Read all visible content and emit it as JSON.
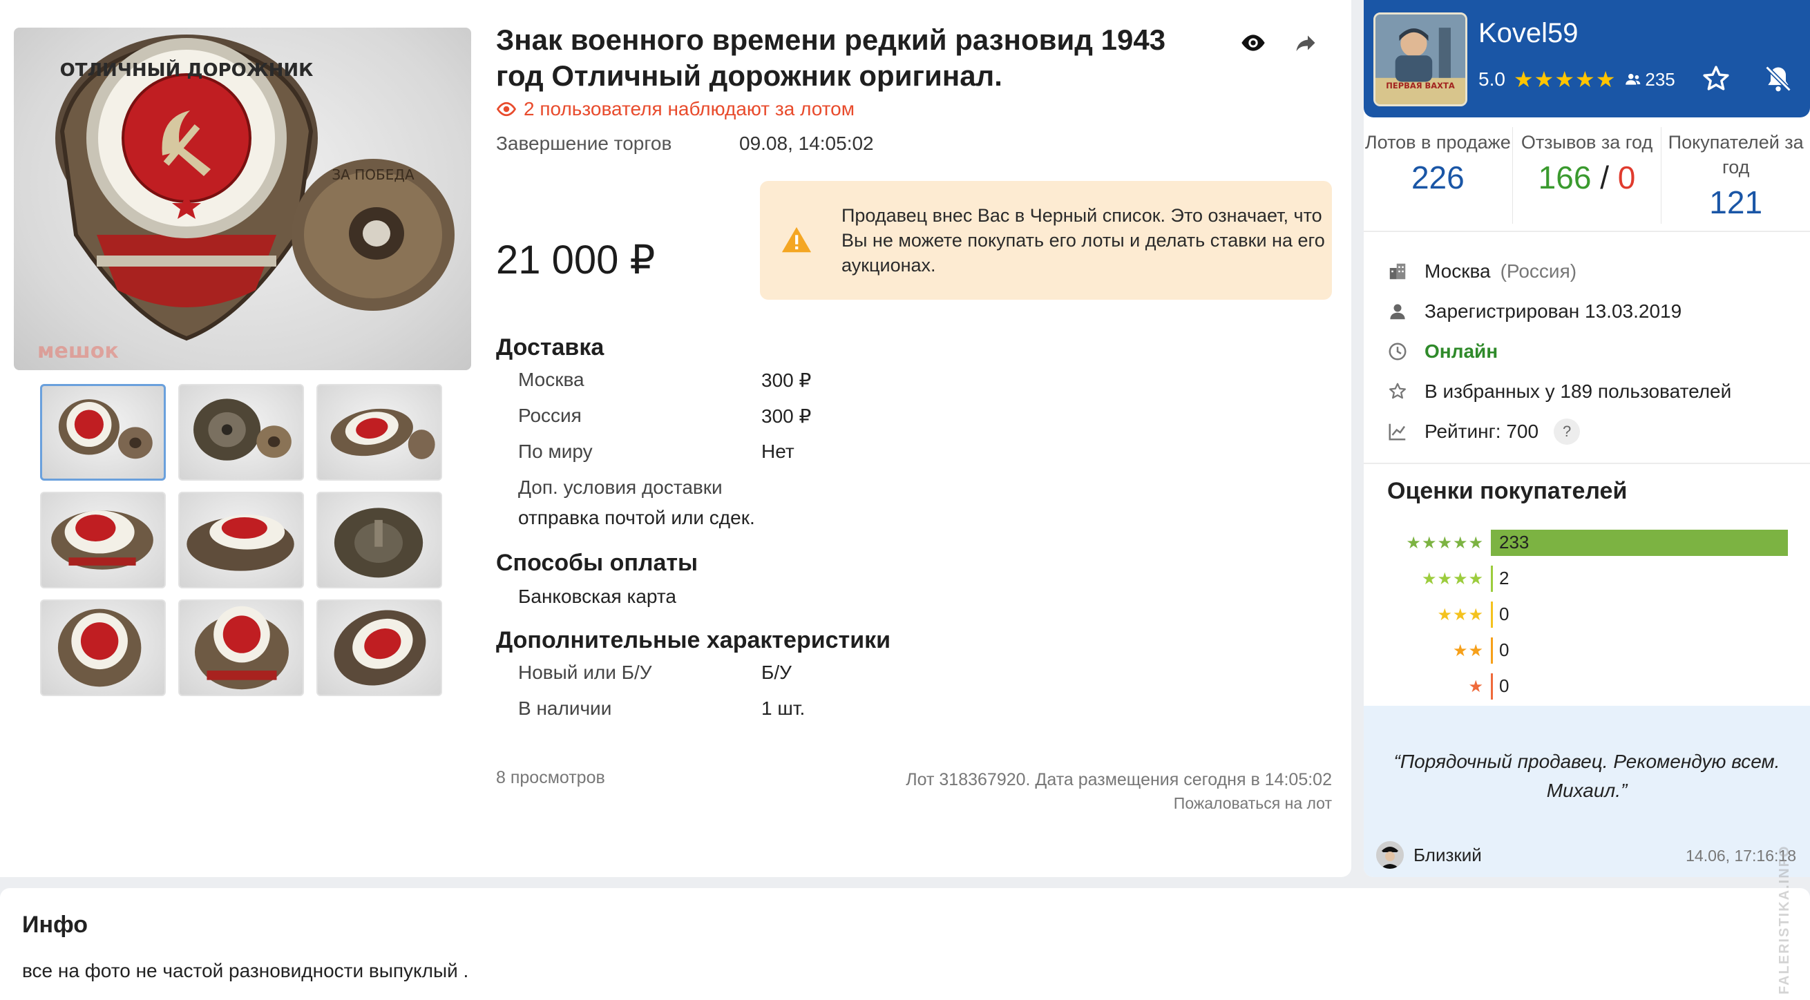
{
  "lot": {
    "title": "Знак военного времени редкий разновид 1943 год Отличный дорожник оригинал.",
    "watchers_text": "2 пользователя наблюдают за лотом",
    "auction_end_label": "Завершение торгов",
    "auction_end_value": "09.08, 14:05:02",
    "price": "21 000 ₽",
    "blacklist_message": "Продавец внес Вас в Черный список. Это означает, что Вы не можете покупать его лоты и делать ставки на его аукционах.",
    "photo_watermark": "мешок",
    "delivery": {
      "title": "Доставка",
      "rows": [
        {
          "label": "Москва",
          "value": "300 ₽"
        },
        {
          "label": "Россия",
          "value": "300 ₽"
        },
        {
          "label": "По миру",
          "value": "Нет"
        }
      ],
      "extra_label": "Доп. условия доставки",
      "extra_value": "отправка почтой или сдек."
    },
    "payment": {
      "title": "Способы оплаты",
      "method": "Банковская карта"
    },
    "characteristics": {
      "title": "Дополнительные характеристики",
      "rows": [
        {
          "label": "Новый или Б/У",
          "value": "Б/У"
        },
        {
          "label": "В наличии",
          "value": "1 шт."
        }
      ]
    },
    "views": "8 просмотров",
    "lot_info": "Лот 318367920. Дата размещения сегодня в 14:05:02",
    "complain": "Пожаловаться на лот"
  },
  "seller": {
    "name": "Kovel59",
    "avatar_caption": "ПЕРВАЯ ВАХТА",
    "rating": "5.0",
    "stars": "★★★★★",
    "followers": "235",
    "stats": {
      "lots_label": "Лотов в продаже",
      "lots_value": "226",
      "reviews_label": "Отзывов за год",
      "reviews_positive": "166",
      "reviews_sep": "/",
      "reviews_negative": "0",
      "buyers_label": "Покупателей за год",
      "buyers_value": "121"
    },
    "city": "Москва",
    "country": "(Россия)",
    "registered": "Зарегистрирован 13.03.2019",
    "status": "Онлайн",
    "favorites": "В избранных у 189 пользователей",
    "rating_text": "Рейтинг: 700",
    "help": "?"
  },
  "ratings": {
    "title": "Оценки покупателей",
    "rows": [
      {
        "stars": "★★★★★",
        "count": "233",
        "share": 1.0,
        "color": "#7cb342"
      },
      {
        "stars": "★★★★",
        "count": "2",
        "share": 0.0,
        "color": "#9ccc3d"
      },
      {
        "stars": "★★★",
        "count": "0",
        "share": 0.0,
        "color": "#f4c21f"
      },
      {
        "stars": "★★",
        "count": "0",
        "share": 0.0,
        "color": "#f6a01a"
      },
      {
        "stars": "★",
        "count": "0",
        "share": 0.0,
        "color": "#ef6a3b"
      }
    ]
  },
  "review": {
    "text": "Порядочный продавец. Рекомендую всем. Михаил.",
    "author": "Близкий",
    "date": "14.06, 17:16:18"
  },
  "info": {
    "title": "Инфо",
    "text": "все на фото не частой разновидности выпуклый ."
  },
  "side_watermark": "FALERISTIKA.INFO",
  "colors": {
    "accent": "#1a56a6",
    "watchers": "#e84b2c",
    "online": "#2f8a2a",
    "warning_bg": "#fdebd2",
    "warning_icon": "#f4a623",
    "review_bg": "#e7f1fb"
  }
}
